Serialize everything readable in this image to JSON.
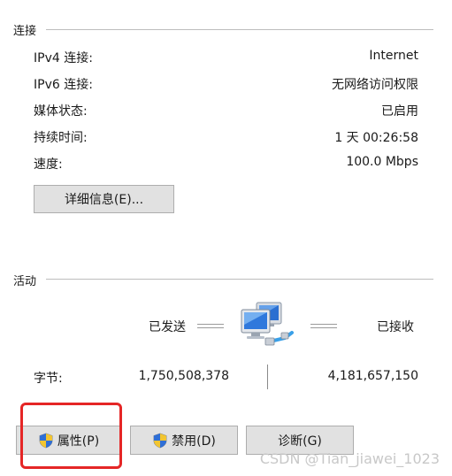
{
  "connection": {
    "section_title": "连接",
    "rows": [
      {
        "label": "IPv4 连接:",
        "value": "Internet"
      },
      {
        "label": "IPv6 连接:",
        "value": "无网络访问权限"
      },
      {
        "label": "媒体状态:",
        "value": "已启用"
      },
      {
        "label": "持续时间:",
        "value": "1 天 00:26:58"
      },
      {
        "label": "速度:",
        "value": "100.0 Mbps"
      }
    ],
    "details_button": "详细信息(E)..."
  },
  "activity": {
    "section_title": "活动",
    "sent_label": "已发送",
    "received_label": "已接收",
    "bytes_label": "字节:",
    "bytes_sent": "1,750,508,378",
    "bytes_received": "4,181,657,150"
  },
  "buttons": {
    "properties": "属性(P)",
    "disable": "禁用(D)",
    "diagnose": "诊断(G)"
  },
  "watermark": "CSDN @Tian_jiawei_1023",
  "icons": {
    "network": "network-computers-icon",
    "shield": "uac-shield-icon"
  },
  "colors": {
    "highlight": "#e52626",
    "button_bg": "#e1e1e1"
  }
}
